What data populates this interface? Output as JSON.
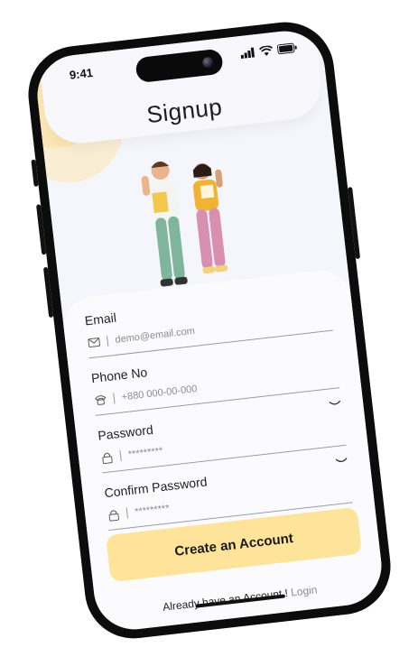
{
  "status_bar": {
    "time": "9:41"
  },
  "header": {
    "title": "Signup"
  },
  "form": {
    "email": {
      "label": "Email",
      "value": "demo@email.com",
      "icon": "mail-icon"
    },
    "phone": {
      "label": "Phone No",
      "value": "+880 000-00-000",
      "icon": "phone-icon"
    },
    "password": {
      "label": "Password",
      "value": "*********",
      "icon": "lock-icon"
    },
    "confirm_password": {
      "label": "Confirm Password",
      "value": "*********",
      "icon": "lock-icon"
    }
  },
  "actions": {
    "create_account_label": "Create an Account"
  },
  "footer": {
    "prompt": "Already have an Account !",
    "login_link": "Login"
  },
  "colors": {
    "accent": "#fde49a",
    "deco_yellow": "#fcd97e",
    "background": "#f5f6fb"
  }
}
